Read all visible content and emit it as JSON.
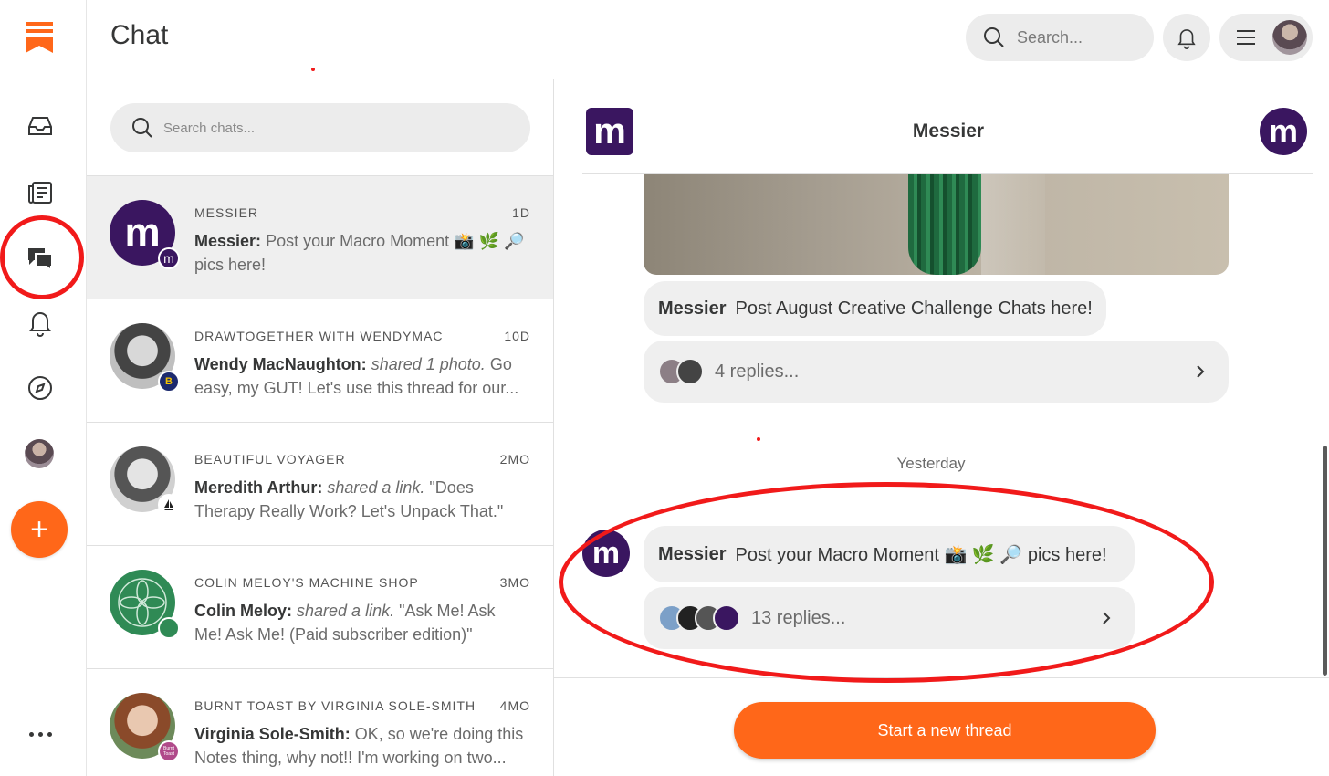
{
  "app": {
    "title": "Chat"
  },
  "top_bar": {
    "search_placeholder": "Search..."
  },
  "rail": {
    "logo": "substack-logo-icon",
    "items": [
      "inbox-icon",
      "reader-icon",
      "chat-icon",
      "bell-icon",
      "explore-icon",
      "profile-avatar"
    ],
    "compose_icon": "+",
    "active_item": "chat-icon"
  },
  "chat_list": {
    "search_placeholder": "Search chats...",
    "items": [
      {
        "publication": "MESSIER",
        "time": "1D",
        "author": "Messier:",
        "preview": "Post your Macro Moment 📸 🌿 🔎 pics here!",
        "avatar_letter": "m",
        "badge_letter": "m",
        "active": true
      },
      {
        "publication": "DRAWTOGETHER WITH WENDYMAC",
        "time": "10D",
        "author": "Wendy MacNaughton:",
        "italic": "shared 1 photo.",
        "preview": "Go easy, my GUT! Let's use this thread for our...",
        "badge_letter": "B"
      },
      {
        "publication": "BEAUTIFUL VOYAGER",
        "time": "2MO",
        "author": "Meredith Arthur:",
        "italic": "shared a link.",
        "preview": "\"Does Therapy Really Work? Let's Unpack That.\""
      },
      {
        "publication": "COLIN MELOY'S MACHINE SHOP",
        "time": "3MO",
        "author": "Colin Meloy:",
        "italic": "shared a link.",
        "preview": "\"Ask Me! Ask Me! Ask Me! (Paid subscriber edition)\""
      },
      {
        "publication": "BURNT TOAST BY VIRGINIA SOLE-SMITH",
        "time": "4MO",
        "author": "Virginia Sole-Smith:",
        "preview": "OK, so we're doing this Notes thing, why not!! I'm working on two...",
        "badge_letter": "Burnt Toast"
      }
    ]
  },
  "thread": {
    "title": "Messier",
    "logo_letter": "m",
    "messages": [
      {
        "author": "Messier",
        "text": "Post August Creative Challenge Chats here!",
        "replies": "4 replies..."
      },
      {
        "author": "Messier",
        "text": "Post your Macro Moment 📸 🌿 🔎 pics here!",
        "replies": "13 replies..."
      }
    ],
    "day_label": "Yesterday",
    "new_thread_label": "Start a new thread"
  },
  "colors": {
    "accent": "#ff6719",
    "messier_purple": "#3a1660",
    "annotation_red": "#f11a1a"
  }
}
